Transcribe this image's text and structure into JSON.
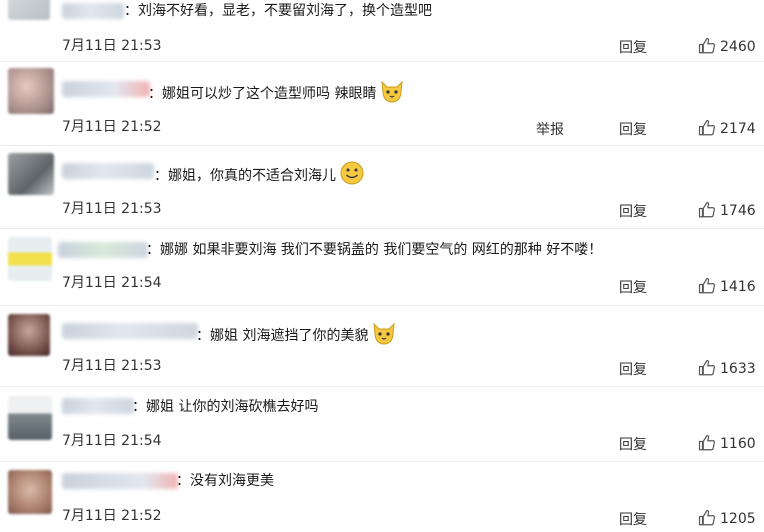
{
  "comments": [
    {
      "text": "：刘海不好看，显老，不要留刘海了，换个造型吧",
      "time": "7月11日 21:53",
      "reply": "回复",
      "likes": "2460"
    },
    {
      "text": "：娜姐可以炒了这个造型师吗 辣眼睛",
      "time": "7月11日 21:52",
      "reply": "回复",
      "report": "举报",
      "likes": "2174",
      "emoji": "cat-emoji"
    },
    {
      "text": "：娜姐，你真的不适合刘海儿",
      "time": "7月11日 21:53",
      "reply": "回复",
      "likes": "1746",
      "emoji": "smile-emoji"
    },
    {
      "text": "：娜娜 如果非要刘海 我们不要锅盖的 我们要空气的 网红的那种 好不喽！",
      "time": "7月11日 21:54",
      "reply": "回复",
      "likes": "1416"
    },
    {
      "text": "：娜姐 刘海遮挡了你的美貌",
      "time": "7月11日 21:53",
      "reply": "回复",
      "likes": "1633",
      "emoji": "cat-emoji"
    },
    {
      "text": "：娜姐 让你的刘海砍樵去好吗",
      "time": "7月11日 21:54",
      "reply": "回复",
      "likes": "1160"
    },
    {
      "text": "：没有刘海更美",
      "time": "7月11日 21:52",
      "reply": "回复",
      "likes": "1205"
    }
  ],
  "colors": {
    "text": "#1a1a1a",
    "meta": "#333333",
    "divider": "#ececec",
    "emoji": "#f5c842"
  }
}
